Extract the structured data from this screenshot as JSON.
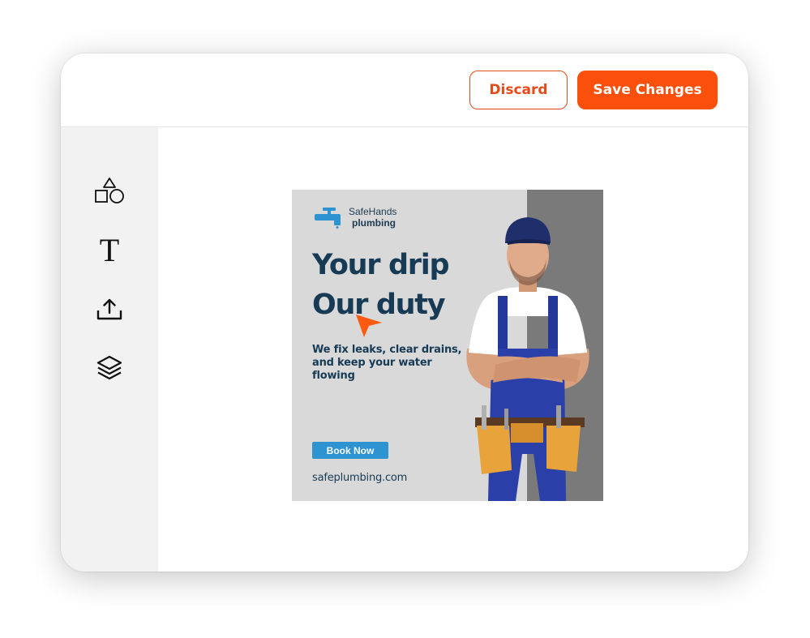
{
  "toolbar": {
    "discard_label": "Discard",
    "save_label": "Save Changes",
    "accent_color": "#fb4f0c"
  },
  "sidebar": {
    "tools": [
      {
        "name": "shapes",
        "icon": "shapes-icon"
      },
      {
        "name": "text",
        "icon": "text-icon",
        "glyph": "T"
      },
      {
        "name": "upload",
        "icon": "upload-icon"
      },
      {
        "name": "layers",
        "icon": "layers-icon"
      }
    ]
  },
  "ad": {
    "brand_name": "SafeHands",
    "brand_sub": "plumbing",
    "headline_1": "Your drip",
    "headline_2": "Our duty",
    "subtext": "We fix leaks, clear drains, and keep your water flowing",
    "cta": "Book Now",
    "url": "safeplumbing.com",
    "colors": {
      "headline": "#173a55",
      "cta_bg": "#2e93d1",
      "background": "#d9d9d9",
      "band": "#7a7a7a"
    }
  }
}
